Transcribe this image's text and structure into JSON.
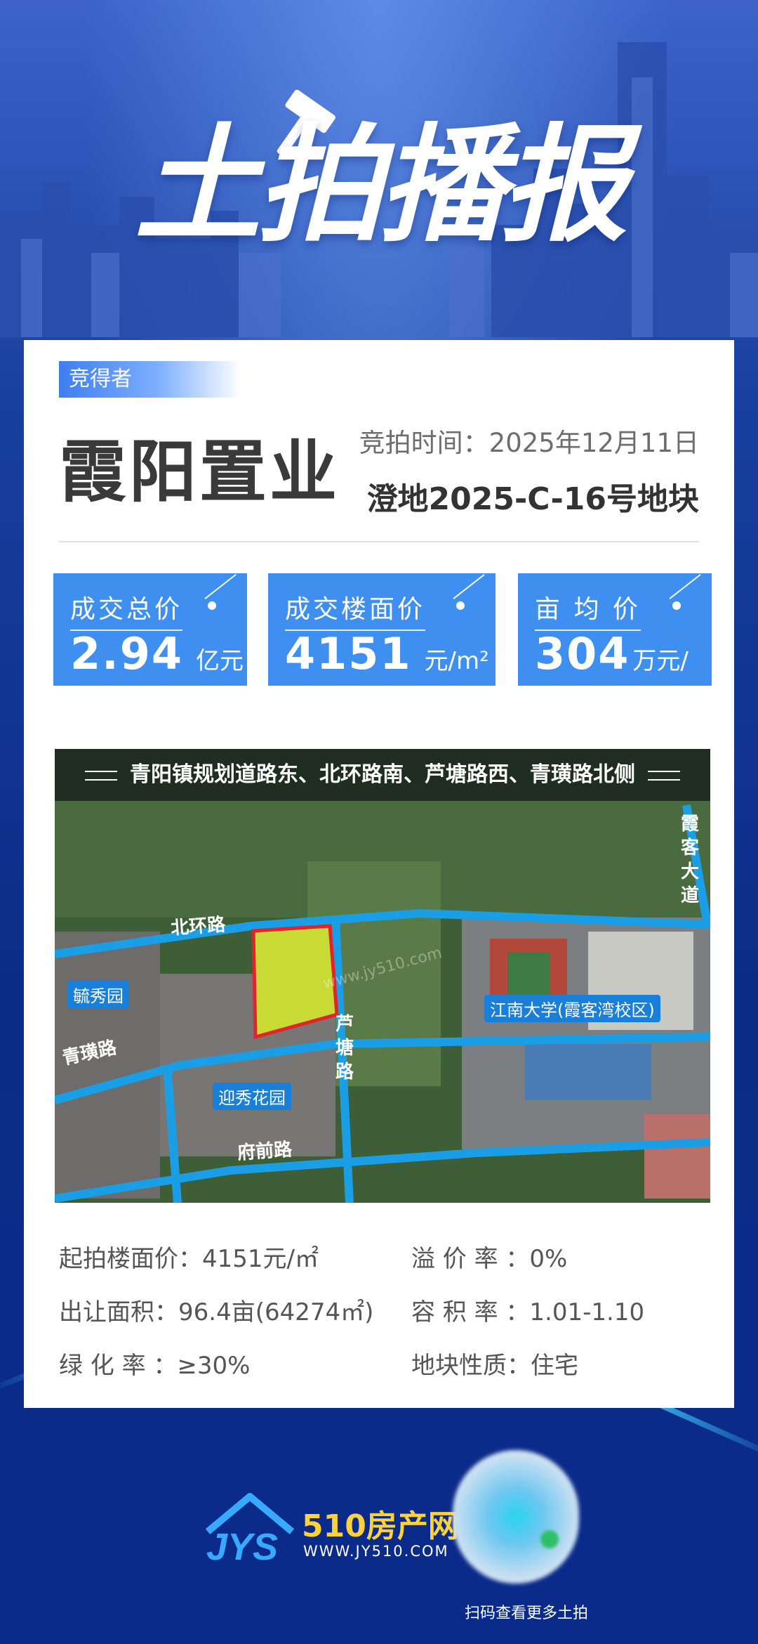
{
  "header": {
    "title": "土拍播报"
  },
  "card": {
    "winner_tag": "竞得者",
    "winner": "霞阳置业",
    "auction_time": "竞拍时间：2025年12月11日",
    "plot_code": "澄地2025-C-16号地块"
  },
  "stats": [
    {
      "label": "成交总价",
      "value": "2.94",
      "unit": "亿元"
    },
    {
      "label": "成交楼面价",
      "value": "4151",
      "unit": "元/m²"
    },
    {
      "label": "亩 均 价",
      "value": "304",
      "unit": "万元/亩"
    }
  ],
  "map": {
    "location": "青阳镇规划道路东、北环路南、芦塘路西、青璜路北侧",
    "labels": {
      "beihuan": "北环路",
      "yuxiu": "毓秀园",
      "qinghuang": "青璜路",
      "yingxiu": "迎秀花园",
      "lutang": "芦塘路",
      "fuqian": "府前路",
      "jiangnan": "江南大学(霞客湾校区)",
      "xiake": "霞客大道"
    },
    "watermark": "www.jy510.com"
  },
  "details": {
    "start_price": "起拍楼面价：4151元/㎡",
    "premium": "溢 价 率 ：0%",
    "area": "出让面积：96.4亩(64274㎡)",
    "far": "容 积 率 ：1.01-1.10",
    "green": "绿 化 率 ：≥30%",
    "nature": "地块性质：住宅"
  },
  "footer": {
    "logo_text": "510房产网",
    "logo_sub": "WWW.JY510.COM",
    "qr_caption": "扫码查看更多土拍"
  }
}
